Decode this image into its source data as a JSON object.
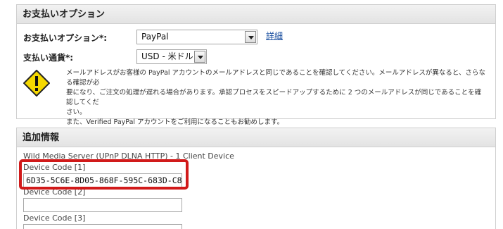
{
  "payment": {
    "header": "お支払いオプション",
    "option_label": "お支払いオプション*:",
    "option_value": "PayPal",
    "details_link": "詳細",
    "currency_label": "支払い通貨*:",
    "currency_value": "USD - 米ドル",
    "warning_line1": "メールアドレスがお客様の PayPal アカウントのメールアドレスと同じであることを確認してください。メールアドレスが異なると、さらなる確認が必",
    "warning_line2": "要になり、ご注文の処理が遅れる場合があります。承認プロセスをスピードアップするために 2 つのメールアドレスが同じであることを確認してくだ",
    "warning_line3": "さい。",
    "warning_line4": "また、Verified PayPal アカウントをご利用になることもお勧めします。",
    "warning_icon": "warning-icon"
  },
  "extra": {
    "header": "追加情報",
    "product": "Wild Media Server (UPnP DLNA HTTP) - 1 Client Device",
    "device_code_1_label": "Device Code [1]",
    "device_code_1_value": "6D35-5C6E-8D05-868F-595C-683D-C8",
    "device_code_2_label": "Device Code [2]",
    "device_code_2_value": "",
    "device_code_3_label": "Device Code [3]",
    "device_code_3_value": ""
  },
  "colors": {
    "highlight": "#d11a1a",
    "link": "#1a4fa0",
    "warning_fill": "#f5d800"
  }
}
